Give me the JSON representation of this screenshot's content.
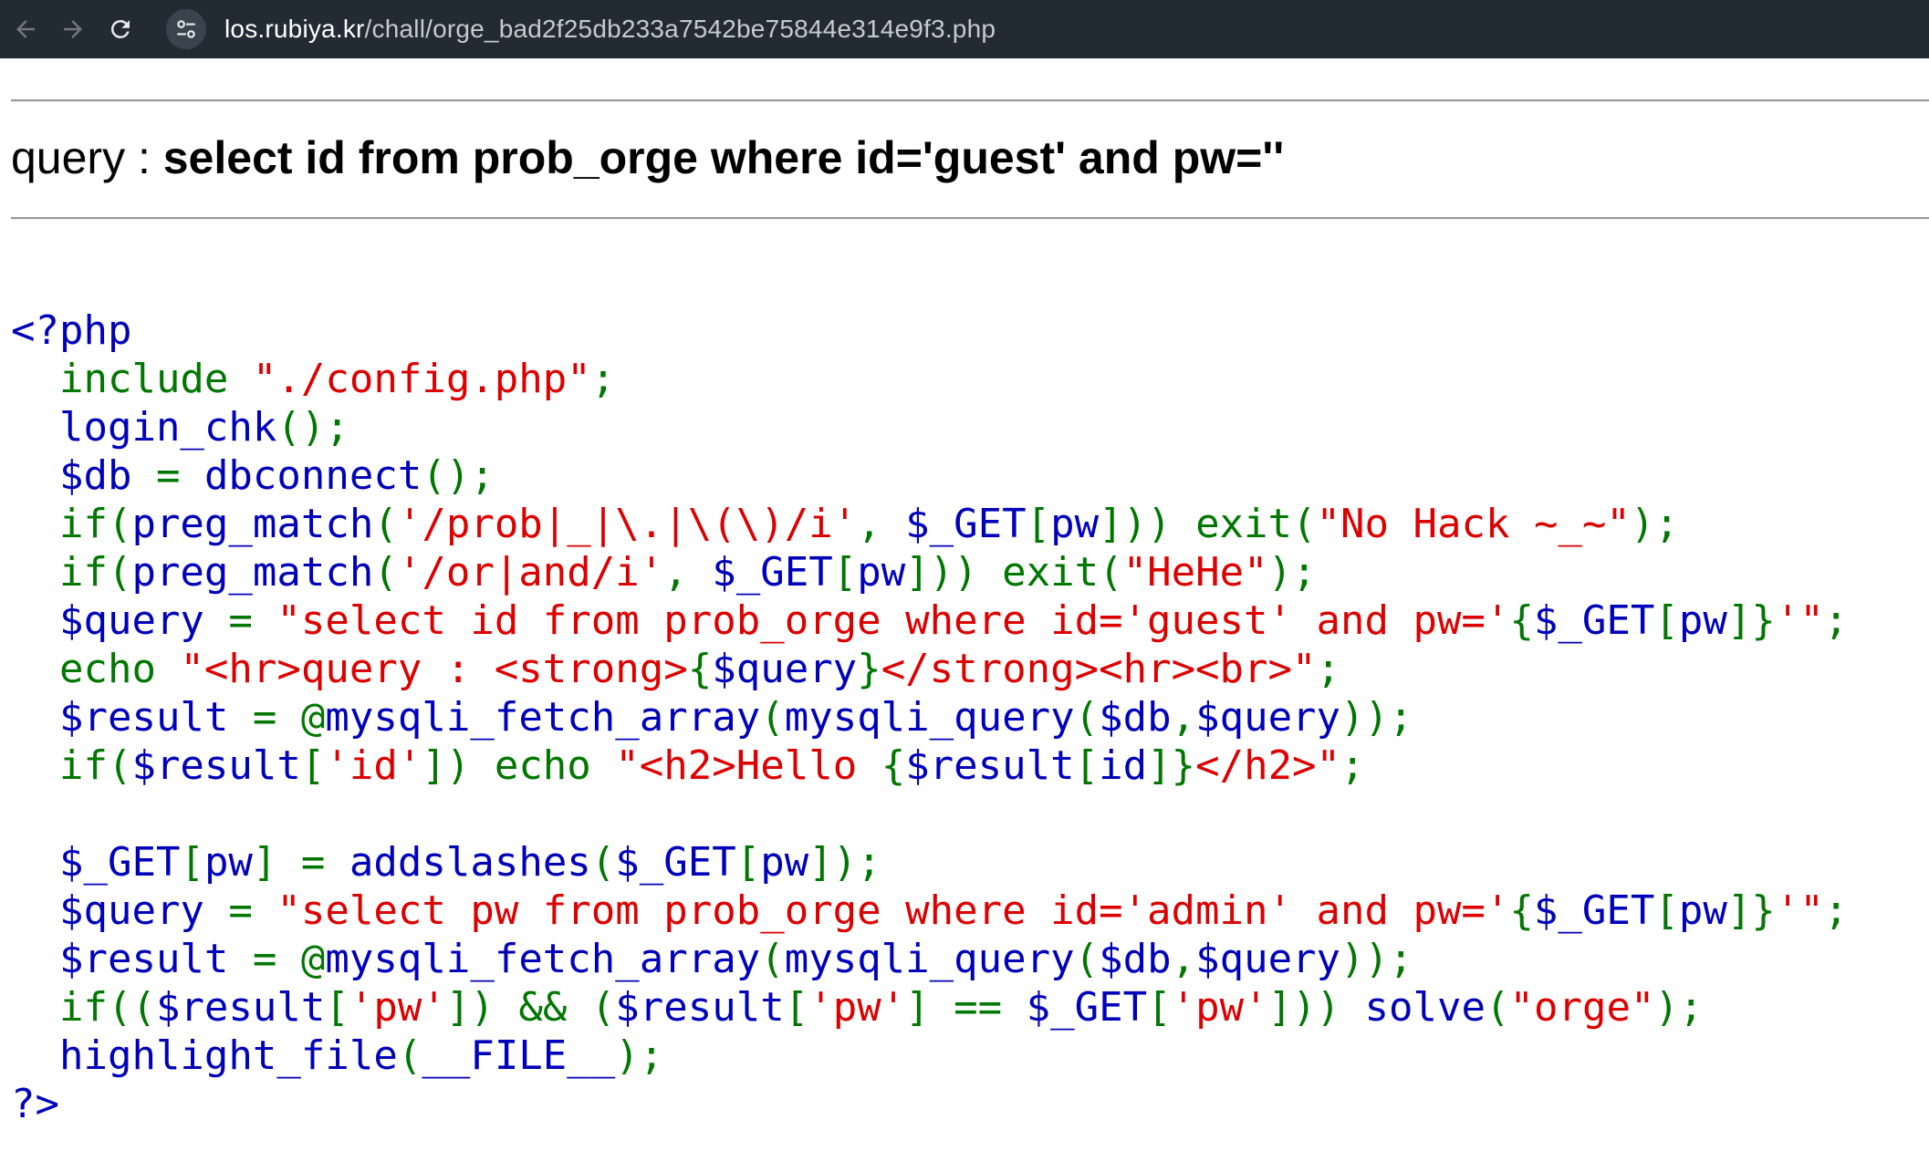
{
  "browser": {
    "url_host": "los.rubiya.kr",
    "url_path": "/chall/orge_bad2f25db233a7542be75844e314e9f3.php",
    "icons": [
      "back-arrow-icon",
      "forward-arrow-icon",
      "reload-icon",
      "site-settings-icon"
    ]
  },
  "query_output": {
    "label": "query : ",
    "sql": "select id from prob_orge where id='guest' and pw=''"
  },
  "source": {
    "lines": [
      [
        {
          "t": "<?php",
          "c": "d"
        }
      ],
      [
        {
          "t": "  include ",
          "c": "k"
        },
        {
          "t": "\"./config.php\"",
          "c": "s"
        },
        {
          "t": ";",
          "c": "k"
        }
      ],
      [
        {
          "t": "  login_chk",
          "c": "d"
        },
        {
          "t": "();",
          "c": "k"
        }
      ],
      [
        {
          "t": "  $db ",
          "c": "d"
        },
        {
          "t": "= ",
          "c": "k"
        },
        {
          "t": "dbconnect",
          "c": "d"
        },
        {
          "t": "();",
          "c": "k"
        }
      ],
      [
        {
          "t": "  if(",
          "c": "k"
        },
        {
          "t": "preg_match",
          "c": "d"
        },
        {
          "t": "(",
          "c": "k"
        },
        {
          "t": "'/prob|_|\\.|\\(\\)/i'",
          "c": "s"
        },
        {
          "t": ", ",
          "c": "k"
        },
        {
          "t": "$_GET",
          "c": "d"
        },
        {
          "t": "[",
          "c": "k"
        },
        {
          "t": "pw",
          "c": "d"
        },
        {
          "t": "])) exit(",
          "c": "k"
        },
        {
          "t": "\"No Hack ~_~\"",
          "c": "s"
        },
        {
          "t": ");",
          "c": "k"
        }
      ],
      [
        {
          "t": "  if(",
          "c": "k"
        },
        {
          "t": "preg_match",
          "c": "d"
        },
        {
          "t": "(",
          "c": "k"
        },
        {
          "t": "'/or|and/i'",
          "c": "s"
        },
        {
          "t": ", ",
          "c": "k"
        },
        {
          "t": "$_GET",
          "c": "d"
        },
        {
          "t": "[",
          "c": "k"
        },
        {
          "t": "pw",
          "c": "d"
        },
        {
          "t": "])) exit(",
          "c": "k"
        },
        {
          "t": "\"HeHe\"",
          "c": "s"
        },
        {
          "t": ");",
          "c": "k"
        }
      ],
      [
        {
          "t": "  $query ",
          "c": "d"
        },
        {
          "t": "= ",
          "c": "k"
        },
        {
          "t": "\"select id from prob_orge where id='guest' and pw='",
          "c": "s"
        },
        {
          "t": "{",
          "c": "k"
        },
        {
          "t": "$_GET",
          "c": "d"
        },
        {
          "t": "[",
          "c": "k"
        },
        {
          "t": "pw",
          "c": "d"
        },
        {
          "t": "]}",
          "c": "k"
        },
        {
          "t": "'\"",
          "c": "s"
        },
        {
          "t": ";",
          "c": "k"
        }
      ],
      [
        {
          "t": "  echo ",
          "c": "k"
        },
        {
          "t": "\"<hr>query : <strong>",
          "c": "s"
        },
        {
          "t": "{",
          "c": "k"
        },
        {
          "t": "$query",
          "c": "d"
        },
        {
          "t": "}",
          "c": "k"
        },
        {
          "t": "</strong><hr><br>\"",
          "c": "s"
        },
        {
          "t": ";",
          "c": "k"
        }
      ],
      [
        {
          "t": "  $result ",
          "c": "d"
        },
        {
          "t": "= @",
          "c": "k"
        },
        {
          "t": "mysqli_fetch_array",
          "c": "d"
        },
        {
          "t": "(",
          "c": "k"
        },
        {
          "t": "mysqli_query",
          "c": "d"
        },
        {
          "t": "(",
          "c": "k"
        },
        {
          "t": "$db",
          "c": "d"
        },
        {
          "t": ",",
          "c": "k"
        },
        {
          "t": "$query",
          "c": "d"
        },
        {
          "t": "));",
          "c": "k"
        }
      ],
      [
        {
          "t": "  if(",
          "c": "k"
        },
        {
          "t": "$result",
          "c": "d"
        },
        {
          "t": "[",
          "c": "k"
        },
        {
          "t": "'id'",
          "c": "s"
        },
        {
          "t": "]) echo ",
          "c": "k"
        },
        {
          "t": "\"<h2>Hello ",
          "c": "s"
        },
        {
          "t": "{",
          "c": "k"
        },
        {
          "t": "$result",
          "c": "d"
        },
        {
          "t": "[",
          "c": "k"
        },
        {
          "t": "id",
          "c": "d"
        },
        {
          "t": "]}",
          "c": "k"
        },
        {
          "t": "</h2>\"",
          "c": "s"
        },
        {
          "t": ";",
          "c": "k"
        }
      ],
      [
        {
          "t": "",
          "c": "d"
        }
      ],
      [
        {
          "t": "  $_GET",
          "c": "d"
        },
        {
          "t": "[",
          "c": "k"
        },
        {
          "t": "pw",
          "c": "d"
        },
        {
          "t": "] = ",
          "c": "k"
        },
        {
          "t": "addslashes",
          "c": "d"
        },
        {
          "t": "(",
          "c": "k"
        },
        {
          "t": "$_GET",
          "c": "d"
        },
        {
          "t": "[",
          "c": "k"
        },
        {
          "t": "pw",
          "c": "d"
        },
        {
          "t": "]);",
          "c": "k"
        }
      ],
      [
        {
          "t": "  $query ",
          "c": "d"
        },
        {
          "t": "= ",
          "c": "k"
        },
        {
          "t": "\"select pw from prob_orge where id='admin' and pw='",
          "c": "s"
        },
        {
          "t": "{",
          "c": "k"
        },
        {
          "t": "$_GET",
          "c": "d"
        },
        {
          "t": "[",
          "c": "k"
        },
        {
          "t": "pw",
          "c": "d"
        },
        {
          "t": "]}",
          "c": "k"
        },
        {
          "t": "'\"",
          "c": "s"
        },
        {
          "t": ";",
          "c": "k"
        }
      ],
      [
        {
          "t": "  $result ",
          "c": "d"
        },
        {
          "t": "= @",
          "c": "k"
        },
        {
          "t": "mysqli_fetch_array",
          "c": "d"
        },
        {
          "t": "(",
          "c": "k"
        },
        {
          "t": "mysqli_query",
          "c": "d"
        },
        {
          "t": "(",
          "c": "k"
        },
        {
          "t": "$db",
          "c": "d"
        },
        {
          "t": ",",
          "c": "k"
        },
        {
          "t": "$query",
          "c": "d"
        },
        {
          "t": "));",
          "c": "k"
        }
      ],
      [
        {
          "t": "  if((",
          "c": "k"
        },
        {
          "t": "$result",
          "c": "d"
        },
        {
          "t": "[",
          "c": "k"
        },
        {
          "t": "'pw'",
          "c": "s"
        },
        {
          "t": "]) && (",
          "c": "k"
        },
        {
          "t": "$result",
          "c": "d"
        },
        {
          "t": "[",
          "c": "k"
        },
        {
          "t": "'pw'",
          "c": "s"
        },
        {
          "t": "] == ",
          "c": "k"
        },
        {
          "t": "$_GET",
          "c": "d"
        },
        {
          "t": "[",
          "c": "k"
        },
        {
          "t": "'pw'",
          "c": "s"
        },
        {
          "t": "])) ",
          "c": "k"
        },
        {
          "t": "solve",
          "c": "d"
        },
        {
          "t": "(",
          "c": "k"
        },
        {
          "t": "\"orge\"",
          "c": "s"
        },
        {
          "t": ");",
          "c": "k"
        }
      ],
      [
        {
          "t": "  highlight_file",
          "c": "d"
        },
        {
          "t": "(",
          "c": "k"
        },
        {
          "t": "__FILE__",
          "c": "d"
        },
        {
          "t": ");",
          "c": "k"
        }
      ],
      [
        {
          "t": "?>",
          "c": "d"
        }
      ]
    ]
  }
}
